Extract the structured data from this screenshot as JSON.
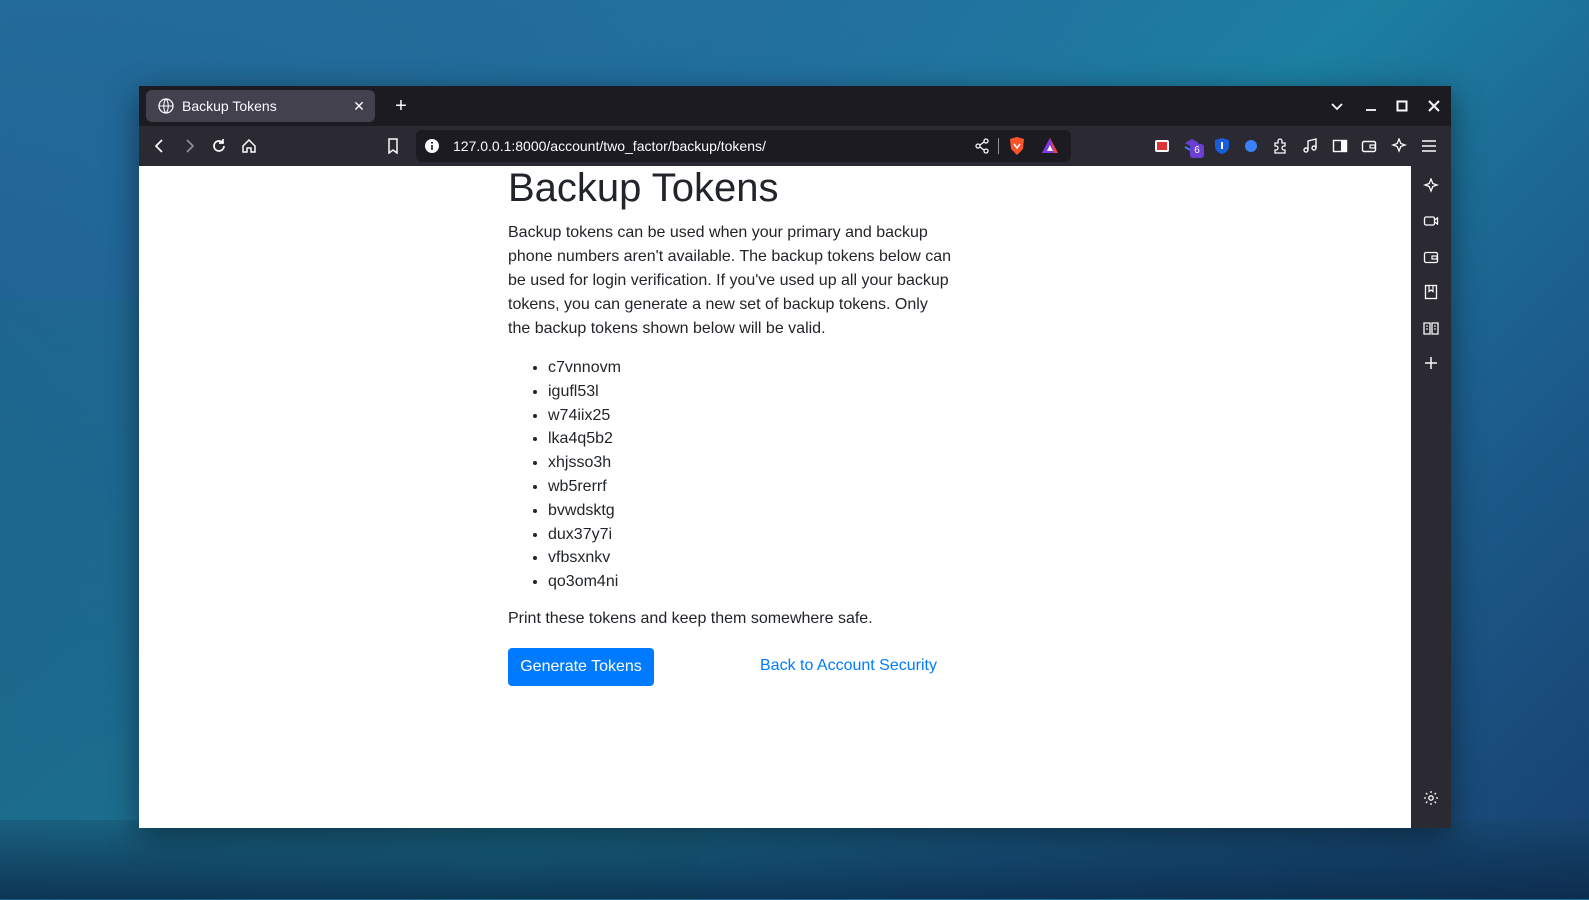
{
  "browser": {
    "tab_title": "Backup Tokens",
    "url": "127.0.0.1:8000/account/two_factor/backup/tokens/",
    "extension_badge": "6"
  },
  "page": {
    "title": "Backup Tokens",
    "description": "Backup tokens can be used when your primary and backup phone numbers aren't available. The backup tokens below can be used for login verification. If you've used up all your backup tokens, you can generate a new set of backup tokens. Only the backup tokens shown below will be valid.",
    "tokens": [
      "c7vnnovm",
      "igufl53l",
      "w74iix25",
      "lka4q5b2",
      "xhjsso3h",
      "wb5rerrf",
      "bvwdsktg",
      "dux37y7i",
      "vfbsxnkv",
      "qo3om4ni"
    ],
    "note": "Print these tokens and keep them somewhere safe.",
    "generate_button": "Generate Tokens",
    "back_link": "Back to Account Security"
  },
  "colors": {
    "primary": "#007bff",
    "text": "#212529",
    "chrome_dark": "#1c1b22",
    "chrome": "#2b2a33"
  }
}
